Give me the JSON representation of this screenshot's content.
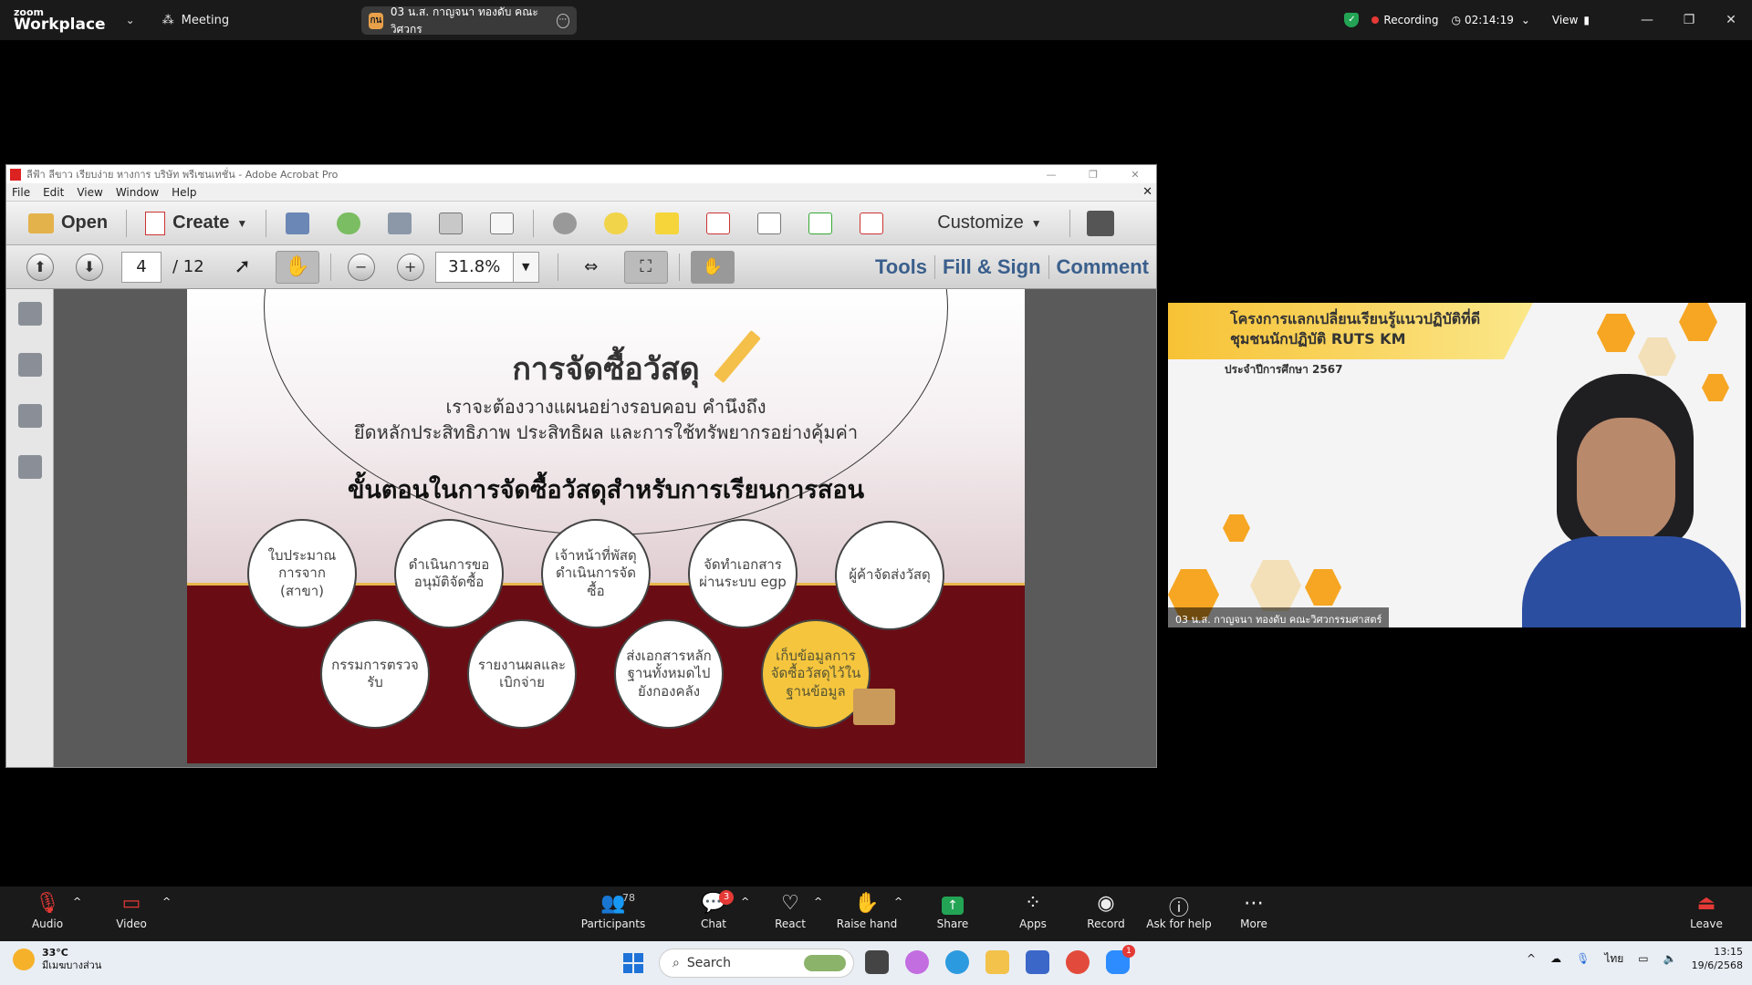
{
  "zoom": {
    "logo_small": "zoom",
    "logo_big": "Workplace",
    "meeting_label": "Meeting",
    "share_label": "03 น.ส. กาญจนา  ทองดับ คณะวิศวกร",
    "share_icon_text": "กน",
    "recording_label": "Recording",
    "timer": "02:14:19",
    "view_label": "View"
  },
  "acrobat": {
    "window_title": "ลีฟ้า ลีขาว เรียบง่าย หางการ บริษัท พรีเซนเทชั่น - Adobe Acrobat Pro",
    "menu": [
      "File",
      "Edit",
      "View",
      "Window",
      "Help"
    ],
    "open_label": "Open",
    "create_label": "Create",
    "customize_label": "Customize",
    "page_current": "4",
    "page_total": "/ 12",
    "zoom_value": "31.8%",
    "tabs": [
      "Tools",
      "Fill & Sign",
      "Comment"
    ]
  },
  "slide": {
    "title": "การจัดซื้อวัสดุ",
    "subtitle1": "เราจะต้องวางแผนอย่างรอบคอบ คำนึงถึง",
    "subtitle2": "ยึดหลักประสิทธิภาพ ประสิทธิผล และการใช้ทรัพยากรอย่างคุ้มค่า",
    "heading": "ขั้นตอนในการจัดซื้อวัสดุสำหรับการเรียนการสอน",
    "bubbles": [
      "ใบประมาณการจาก (สาขา)",
      "ดำเนินการขออนุมัติจัดซื้อ",
      "เจ้าหน้าที่พัสดุดำเนินการจัดซื้อ",
      "จัดทำเอกสารผ่านระบบ egp",
      "ผู้ค้าจัดส่งวัสดุ",
      "กรรมการตรวจรับ",
      "รายงานผลและเบิกจ่าย",
      "ส่งเอกสารหลักฐานทั้งหมดไปยังกองคลัง",
      "เก็บข้อมูลการจัดซื้อวัสดุไว้ในฐานข้อมูล"
    ]
  },
  "video": {
    "banner_line1": "โครงการแลกเปลี่ยนเรียนรู้แนวปฏิบัติที่ดี",
    "banner_line2": "ชุมชนนักปฏิบัติ RUTS KM",
    "banner_line3": "ประจำปีการศึกษา 2567",
    "name_tag": "03 น.ส. กาญจนา  ทองดับ คณะวิศวกรรมศาสตร์"
  },
  "bottom_bar": {
    "audio": "Audio",
    "video": "Video",
    "participants": "Participants",
    "participants_count": "78",
    "chat": "Chat",
    "chat_badge": "3",
    "react": "React",
    "raise_hand": "Raise hand",
    "share": "Share",
    "apps": "Apps",
    "record": "Record",
    "ask_help": "Ask for help",
    "more": "More",
    "leave": "Leave"
  },
  "taskbar": {
    "temperature": "33°C",
    "weather_desc": "มีเมฆบางส่วน",
    "search_placeholder": "Search",
    "lang": "ไทย",
    "time": "13:15",
    "date": "19/6/2568",
    "zoom_badge": "1"
  },
  "colors": {
    "slide_bottom": "#6a0c14",
    "gold": "#f5c53e",
    "acro_tab": "#3a5f8c",
    "recording": "#e53935"
  }
}
